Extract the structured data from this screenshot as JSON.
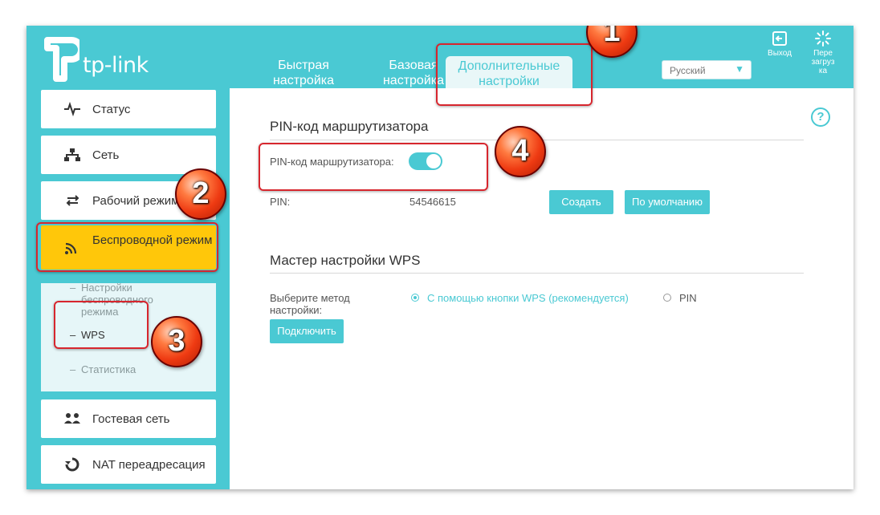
{
  "brand": {
    "logo_text": "tp-link"
  },
  "header": {
    "tabs": [
      {
        "line1": "Быстрая",
        "line2": "настройка"
      },
      {
        "line1": "Базовая",
        "line2": "настройка"
      },
      {
        "line1": "Дополнительные",
        "line2": "настройки"
      }
    ],
    "language": "Русский",
    "logout_label": "Выход",
    "reboot_label": [
      "Пере",
      "загруз",
      "ка"
    ]
  },
  "sidebar": {
    "items": {
      "status": "Статус",
      "network": "Сеть",
      "op_mode": "Рабочий режим",
      "wireless": "Беспроводной режим",
      "guest": "Гостевая сеть",
      "nat": "NAT переадресация"
    },
    "submenu": {
      "settings": [
        "Настройки",
        "беспроводного",
        "режима"
      ],
      "wps": "WPS",
      "stats": "Статистика"
    },
    "bullet": "–"
  },
  "main": {
    "pin_section": {
      "title": "PIN-код маршрутизатора",
      "toggle_label": "PIN-код маршрутизатора:",
      "toggle_on": true,
      "pin_label": "PIN:",
      "pin_value": "54546615",
      "create_button": "Создать",
      "default_button": "По умолчанию"
    },
    "wps_section": {
      "title": "Мастер настройки WPS",
      "method_label": [
        "Выберите метод",
        "настройки:"
      ],
      "option_button": "С помощью кнопки WPS (рекомендуется)",
      "option_pin": "PIN",
      "selected": "button",
      "connect_button": "Подключить"
    },
    "help_glyph": "?"
  },
  "annotations": {
    "badge1": "1",
    "badge2": "2",
    "badge3": "3",
    "badge4": "4"
  },
  "colors": {
    "accent": "#4ac9d3",
    "highlight": "#ffc70a",
    "marker": "#d7262e"
  }
}
